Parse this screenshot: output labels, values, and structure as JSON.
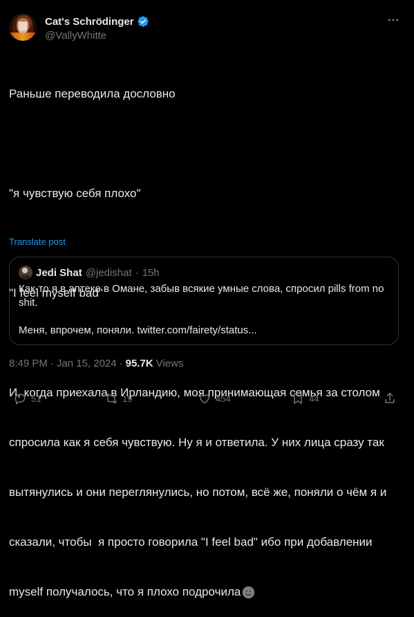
{
  "tweet": {
    "author": {
      "display_name": "Cat's Schrödinger",
      "handle": "@VallyWhitte",
      "verified": true,
      "avatar_icon": "avatar-photo"
    },
    "text_lines": [
      "Раньше переводила дословно",
      "",
      "\"я чувствую себя плохо\"",
      "",
      "\"I feel myself bad\"",
      "",
      "И, когда приехала в Ирландию, моя принимающая семья за столом",
      "спросила как я себя чувствую. Ну я и ответила. У них лица сразу так",
      "вытянулись и они переглянулись, но потом, всё же, поняли о чём я и",
      "сказали, чтобы  я просто говорила \"I feel bad\" ибо при добавлении",
      "myself получалось, что я плохо подрочила"
    ],
    "translate_label": "Translate post",
    "quote": {
      "author_name": "Jedi Shat",
      "author_handle": "@jedishat",
      "separator": "·",
      "time": "15h",
      "lines": [
        "Как-то я в аптеке в Омане, забыв всякие умные слова, спросил pills from no",
        "shit.",
        "",
        "Меня, впрочем, поняли. twitter.com/fairety/status..."
      ]
    },
    "meta": {
      "time": "8:49 PM",
      "separator": "·",
      "date": "Jan 15, 2024",
      "separator2": "·",
      "views_count": "95.7K",
      "views_label": "Views"
    },
    "actions": {
      "reply_count": "51",
      "retweet_count": "19",
      "like_count": "454",
      "bookmark_count": "44",
      "share_label": ""
    }
  },
  "colors": {
    "background": "#000000",
    "text": "#e7e9ea",
    "secondary": "#71767b",
    "accent": "#1d9bf0",
    "border": "#2f3336"
  }
}
